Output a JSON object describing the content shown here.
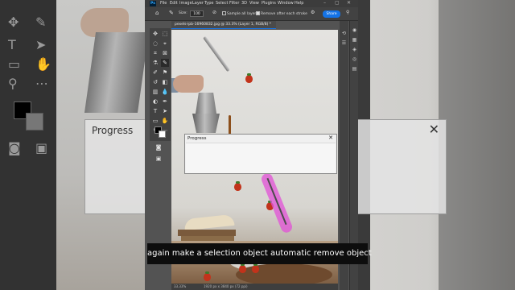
{
  "app": {
    "menu": [
      "File",
      "Edit",
      "Image",
      "Layer",
      "Type",
      "Select",
      "Filter",
      "3D",
      "View",
      "Plugins",
      "Window",
      "Help"
    ],
    "logo": "Ps"
  },
  "options_bar": {
    "size_label": "Size:",
    "size_value": "100",
    "sample_all_layers": "Sample all layers",
    "remove_after_stroke": "Remove after each stroke",
    "share_button": "Share"
  },
  "document": {
    "tab_title": "pexels-ipb-16960832.jpg @ 33.3% (Layer 1, RGB/8) *",
    "zoom": "33.33%",
    "dimensions": "1920 px x 3840 px (72 ppi)"
  },
  "dialog": {
    "title": "Progress",
    "close": "✕"
  },
  "background_dialog": {
    "title": "Progress",
    "close": "✕"
  },
  "caption": {
    "text": "again make a selection object automatic remove object"
  }
}
